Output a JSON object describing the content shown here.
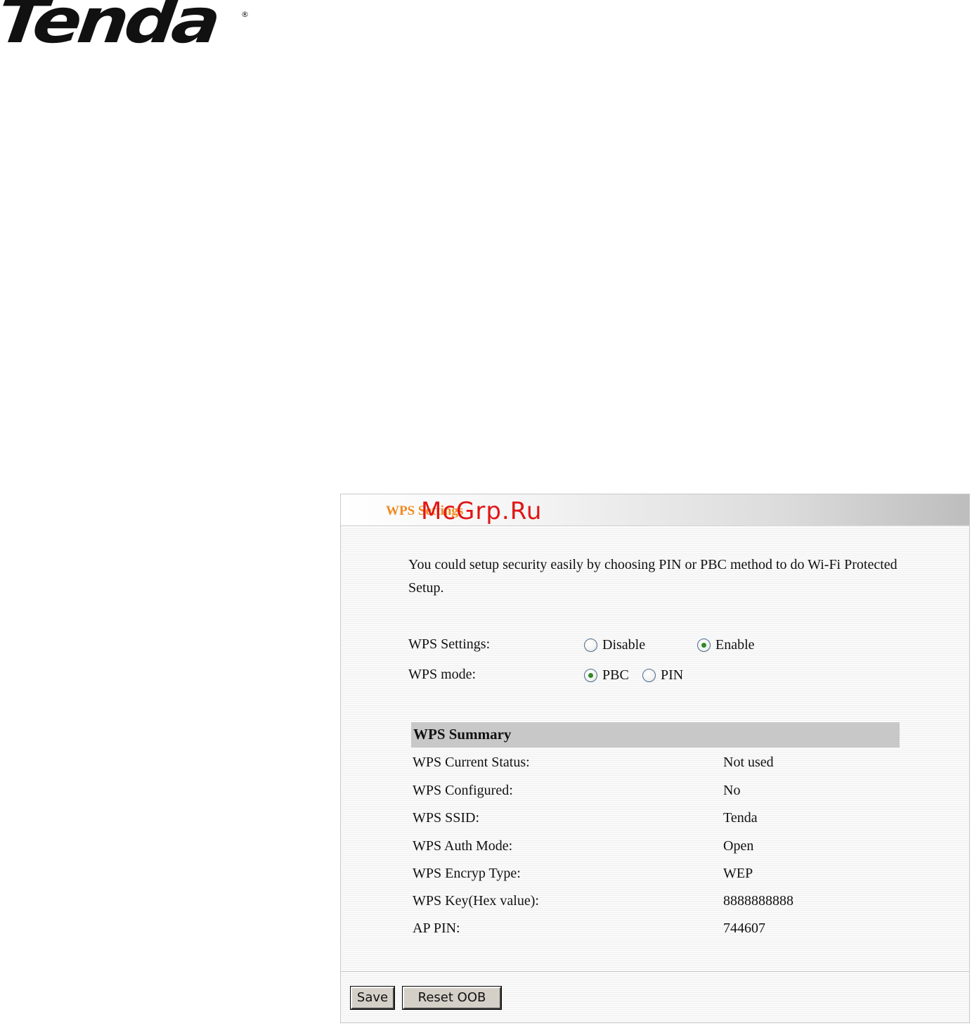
{
  "logo": {
    "text": "Tenda",
    "registered": "®"
  },
  "watermark": "McGrp.Ru",
  "panel": {
    "title": "WPS Settings",
    "intro": "You could setup security easily by choosing PIN or PBC method to do Wi-Fi Protected Setup."
  },
  "wps_settings": {
    "label": "WPS Settings:",
    "options": [
      "Disable",
      "Enable"
    ],
    "selected": "Enable"
  },
  "wps_mode": {
    "label": "WPS mode:",
    "options": [
      "PBC",
      "PIN"
    ],
    "selected": "PBC"
  },
  "summary": {
    "heading": "WPS Summary",
    "rows": [
      {
        "label": "WPS Current Status:",
        "value": "Not used"
      },
      {
        "label": "WPS Configured:",
        "value": "No"
      },
      {
        "label": "WPS SSID:",
        "value": "Tenda"
      },
      {
        "label": "WPS Auth Mode:",
        "value": "Open"
      },
      {
        "label": "WPS Encryp Type:",
        "value": "WEP"
      },
      {
        "label": "WPS Key(Hex value):",
        "value": "8888888888"
      },
      {
        "label": "AP PIN:",
        "value": "744607"
      }
    ]
  },
  "buttons": {
    "save": "Save",
    "reset": "Reset OOB"
  },
  "colors": {
    "title": "#f08a1e",
    "radio_dot": "#2f8a24",
    "summary_header_bg": "#c8c8c8",
    "watermark": "#e11515"
  }
}
